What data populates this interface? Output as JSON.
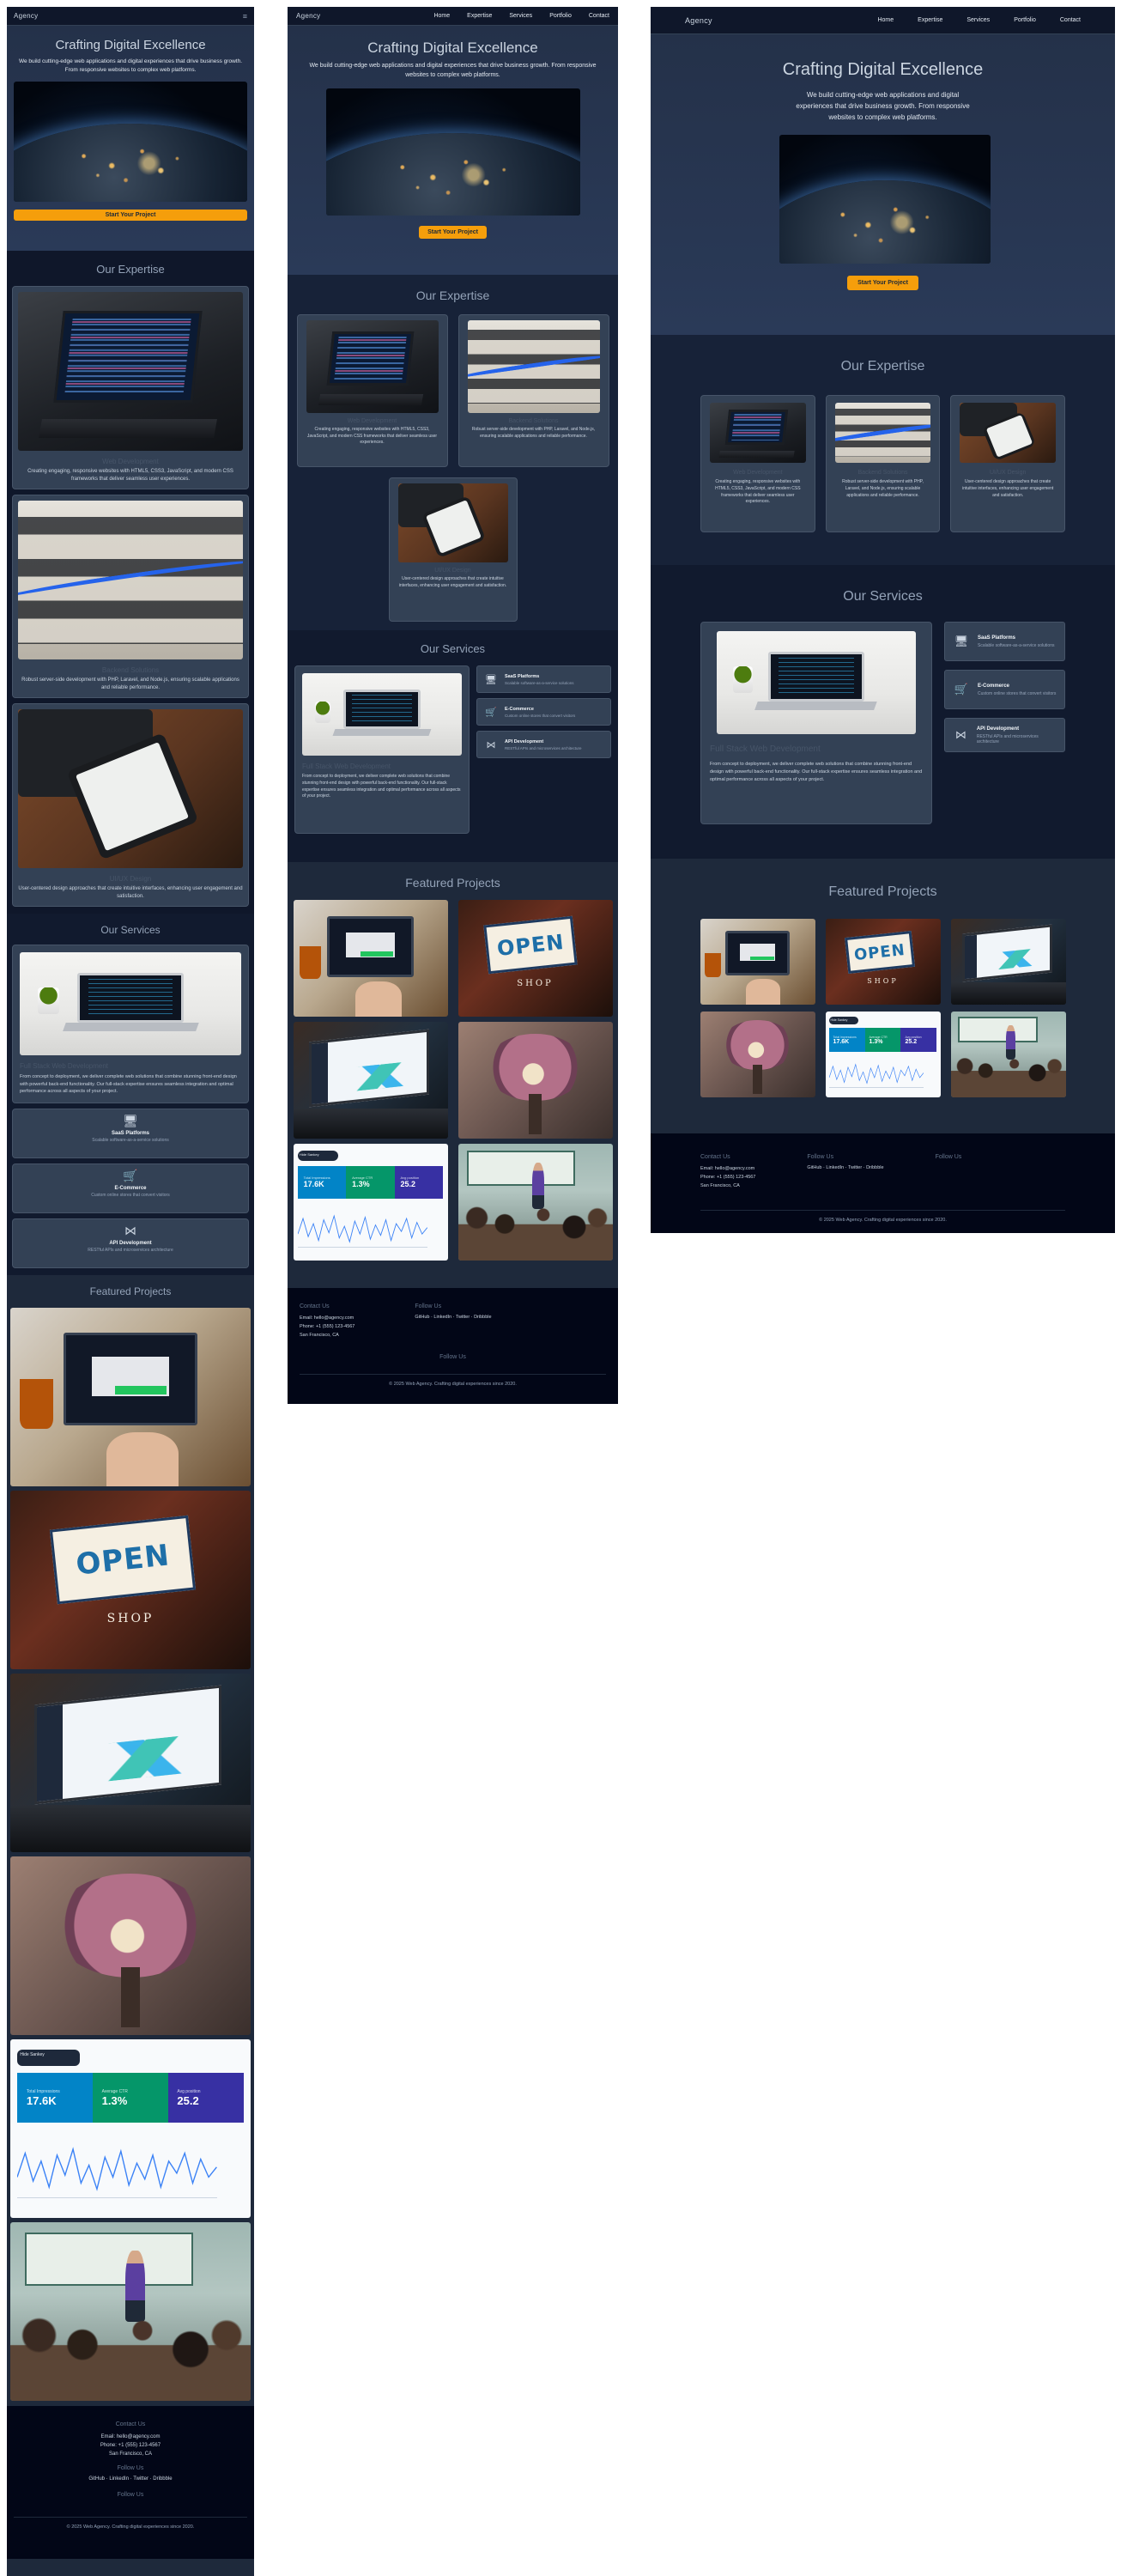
{
  "brand": {
    "logo": "Agency",
    "accent": "#f59e0b",
    "background": "#1e293b",
    "dark": "#0f172a",
    "footer_bg": "#020617"
  },
  "nav": {
    "items": [
      "Home",
      "Expertise",
      "Services",
      "Portfolio",
      "Contact"
    ],
    "menu_icon": "hamburger-icon"
  },
  "hero": {
    "title": "Crafting Digital Excellence",
    "subtitle": "We build cutting-edge web applications and digital experiences that drive business growth. From responsive websites to complex web platforms.",
    "cta": "Start Your Project",
    "image_alt": "earth-at-night"
  },
  "expertise": {
    "title": "Our Expertise",
    "cards": [
      {
        "title": "Web Development",
        "text": "Creating engaging, responsive websites with HTML5, CSS3, JavaScript, and modern CSS frameworks that deliver seamless user experiences.",
        "image": "laptop-code"
      },
      {
        "title": "Backend Solutions",
        "text": "Robust server-side development with PHP, Laravel, and Node.js, ensuring scalable applications and reliable performance.",
        "image": "network-cables"
      },
      {
        "title": "UI/UX Design",
        "text": "User-centered design approaches that create intuitive interfaces, enhancing user engagement and satisfaction.",
        "image": "tablet-design"
      }
    ]
  },
  "services": {
    "title": "Our Services",
    "featured": {
      "title": "Full Stack Web Development",
      "text": "From concept to deployment, we deliver complete web solutions that combine stunning front-end design with powerful back-end functionality. Our full-stack expertise ensures seamless integration and optimal performance across all aspects of your project.",
      "image": "desk-laptop"
    },
    "items": [
      {
        "icon": "monitor-icon",
        "glyph": "🖥",
        "title": "SaaS Platforms",
        "text": "Scalable software-as-a-service solutions"
      },
      {
        "icon": "cart-icon",
        "glyph": "🛒",
        "title": "E-Commerce",
        "text": "Custom online stores that convert visitors"
      },
      {
        "icon": "api-nodes-icon",
        "glyph": "⋈",
        "title": "API Development",
        "text": "RESTful APIs and microservices architecture"
      }
    ]
  },
  "portfolio": {
    "title": "Featured Projects",
    "items": [
      {
        "name": "online-payment",
        "image": "payment"
      },
      {
        "name": "open-shop",
        "image": "open-sign",
        "sign": "OPEN",
        "label": "SHOP"
      },
      {
        "name": "analytics-laptop",
        "image": "analytics"
      },
      {
        "name": "brain-model",
        "image": "brain"
      },
      {
        "name": "analytics-dashboard",
        "image": "dashboard",
        "chip": "Hide Sankey",
        "kpis": [
          {
            "label": "Total Impressions",
            "value": "17.6K"
          },
          {
            "label": "Average CTR",
            "value": "1.3%"
          },
          {
            "label": "Avg position",
            "value": "25.2"
          }
        ]
      },
      {
        "name": "classroom",
        "image": "classroom"
      }
    ]
  },
  "footer": {
    "contact_title": "Contact Us",
    "contact": [
      "Email: hello@agency.com",
      "Phone: +1 (555) 123-4567",
      "San Francisco, CA"
    ],
    "social_title": "Follow Us",
    "social": [
      "GitHub",
      "LinkedIn",
      "Twitter",
      "Dribbble"
    ],
    "social_title_alt": "Follow Us",
    "copyright": "© 2025 Web Agency. Crafting digital experiences since 2020."
  }
}
